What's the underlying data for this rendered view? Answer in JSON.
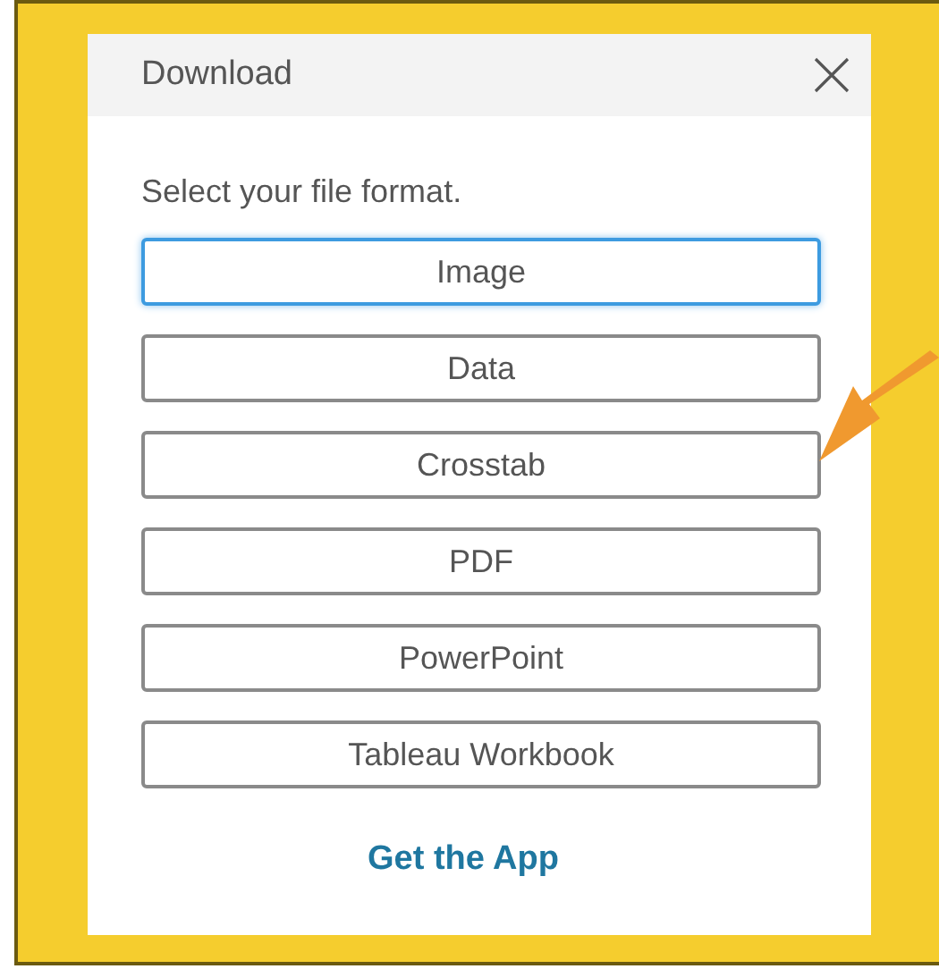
{
  "dialog": {
    "title": "Download",
    "prompt": "Select your file format.",
    "options": [
      {
        "label": "Image",
        "selected": true
      },
      {
        "label": "Data",
        "selected": false
      },
      {
        "label": "Crosstab",
        "selected": false
      },
      {
        "label": "PDF",
        "selected": false
      },
      {
        "label": "PowerPoint",
        "selected": false
      },
      {
        "label": "Tableau Workbook",
        "selected": false
      }
    ],
    "link": "Get the App"
  }
}
